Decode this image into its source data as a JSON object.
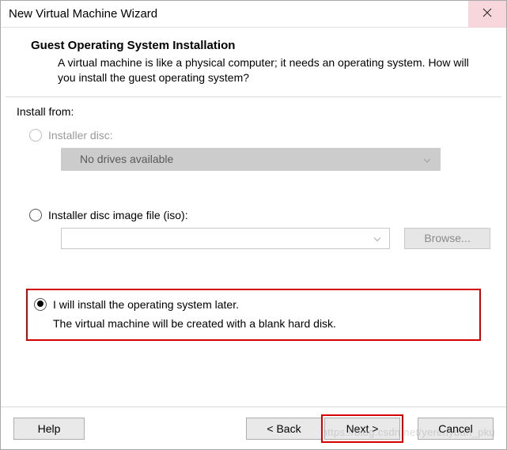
{
  "window": {
    "title": "New Virtual Machine Wizard"
  },
  "header": {
    "title": "Guest Operating System Installation",
    "description": "A virtual machine is like a physical computer; it needs an operating system. How will you install the guest operating system?"
  },
  "install_from_label": "Install from:",
  "options": {
    "disc": {
      "label": "Installer disc:",
      "dropdown_value": "No drives available",
      "enabled": false
    },
    "iso": {
      "label": "Installer disc image file (iso):",
      "input_value": "",
      "browse_label": "Browse...",
      "enabled": true,
      "selected": false
    },
    "later": {
      "label": "I will install the operating system later.",
      "description": "The virtual machine will be created with a blank hard disk.",
      "selected": true
    }
  },
  "footer": {
    "help": "Help",
    "back": "< Back",
    "next": "Next >",
    "cancel": "Cancel"
  },
  "watermark": "https://blog.csdn.net/yerenyuan_pku"
}
